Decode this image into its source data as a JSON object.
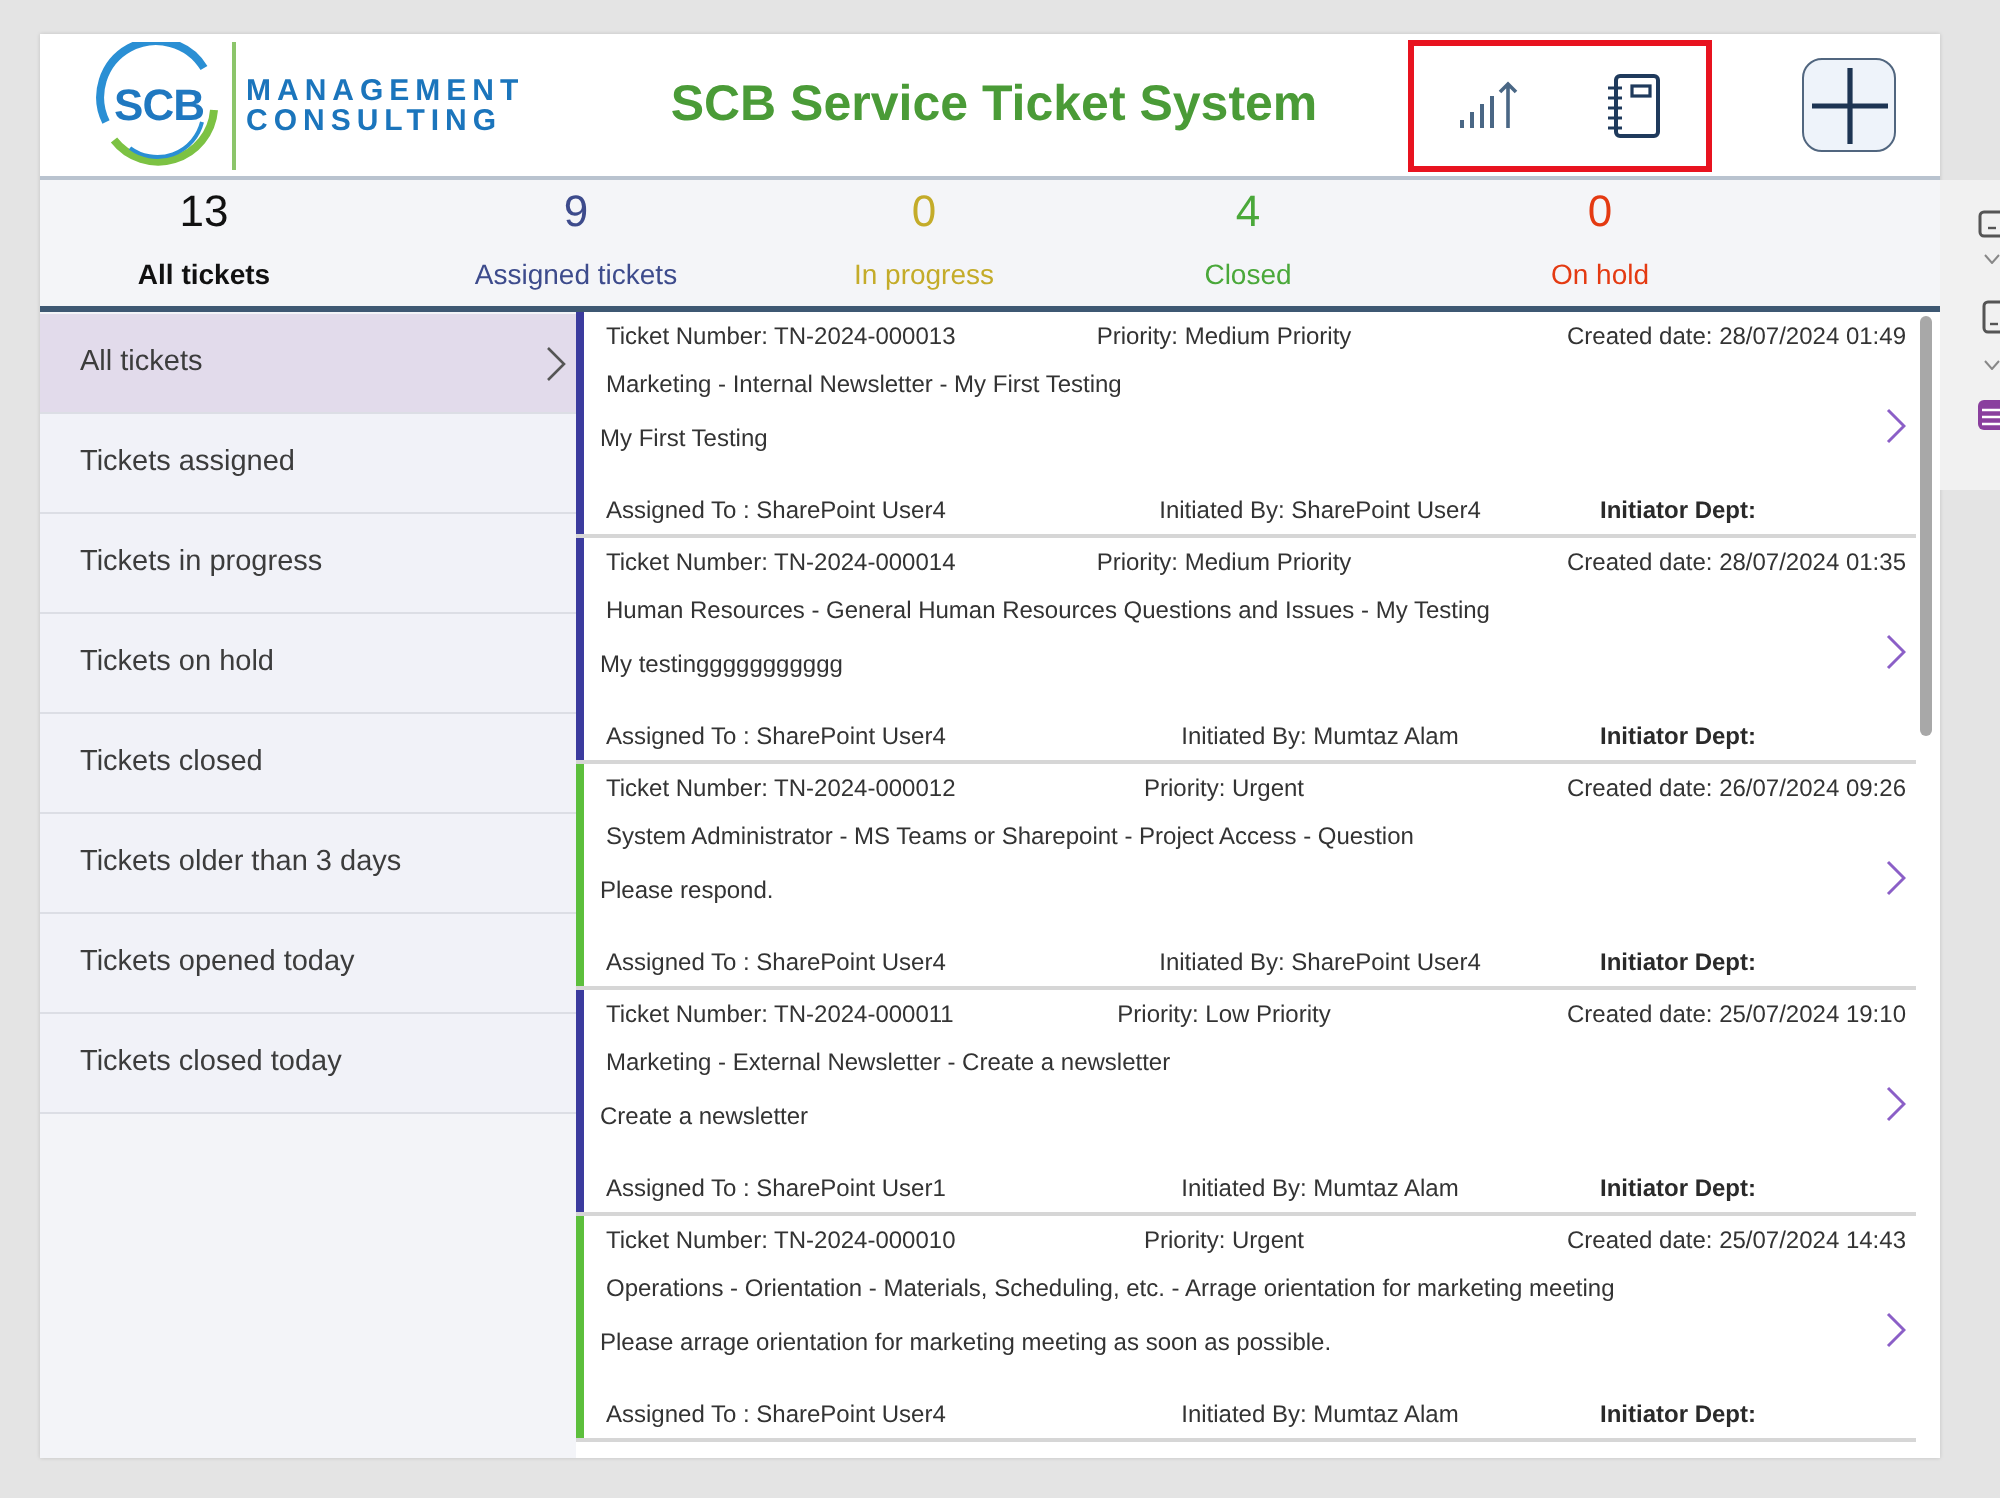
{
  "header": {
    "logo": {
      "initials": "SCB",
      "line1": "MANAGEMENT",
      "line2": "CONSULTING"
    },
    "title": "SCB Service Ticket System",
    "toolbar": {
      "highlighted": true
    }
  },
  "stats": [
    {
      "value": "13",
      "label": "All tickets",
      "color": "#111111",
      "selected": true
    },
    {
      "value": "9",
      "label": "Assigned tickets",
      "color": "#3d4b8c",
      "selected": false
    },
    {
      "value": "0",
      "label": "In progress",
      "color": "#c4ac2a",
      "selected": false
    },
    {
      "value": "4",
      "label": "Closed",
      "color": "#4aa83a",
      "selected": false
    },
    {
      "value": "0",
      "label": "On hold",
      "color": "#e43a12",
      "selected": false
    }
  ],
  "sidebar": {
    "items": [
      {
        "label": "All tickets",
        "selected": true
      },
      {
        "label": "Tickets assigned",
        "selected": false
      },
      {
        "label": "Tickets in progress",
        "selected": false
      },
      {
        "label": "Tickets on hold",
        "selected": false
      },
      {
        "label": "Tickets closed",
        "selected": false
      },
      {
        "label": "Tickets older than 3 days",
        "selected": false
      },
      {
        "label": "Tickets opened today",
        "selected": false
      },
      {
        "label": "Tickets closed today",
        "selected": false
      }
    ]
  },
  "tickets": [
    {
      "number": "Ticket Number: TN-2024-000013",
      "priority": "Priority: Medium Priority",
      "created": "Created date: 28/07/2024 01:49",
      "category": "Marketing - Internal Newsletter - My First Testing",
      "description": "My First Testing",
      "assigned_to": "Assigned To : SharePoint User4",
      "initiated_by": "Initiated By: SharePoint User4",
      "dept": "Initiator Dept:",
      "color": "#3b3b9e"
    },
    {
      "number": "Ticket Number: TN-2024-000014",
      "priority": "Priority: Medium Priority",
      "created": "Created date: 28/07/2024 01:35",
      "category": "Human Resources - General Human Resources Questions and Issues - My Testing",
      "description": "My testinggggggggggg",
      "assigned_to": "Assigned To : SharePoint User4",
      "initiated_by": "Initiated By: Mumtaz Alam",
      "dept": "Initiator Dept:",
      "color": "#3b3b9e"
    },
    {
      "number": "Ticket Number: TN-2024-000012",
      "priority": "Priority: Urgent",
      "created": "Created date: 26/07/2024 09:26",
      "category": "System Administrator - MS Teams or Sharepoint - Project Access - Question",
      "description": "Please respond.",
      "assigned_to": "Assigned To : SharePoint User4",
      "initiated_by": "Initiated By: SharePoint User4",
      "dept": "Initiator Dept:",
      "color": "#5cbf3c"
    },
    {
      "number": "Ticket Number: TN-2024-000011",
      "priority": "Priority: Low Priority",
      "created": "Created date: 25/07/2024 19:10",
      "category": "Marketing - External Newsletter - Create a newsletter",
      "description": "Create a newsletter",
      "assigned_to": "Assigned To : SharePoint User1",
      "initiated_by": "Initiated By: Mumtaz Alam",
      "dept": "Initiator Dept:",
      "color": "#3b3b9e"
    },
    {
      "number": "Ticket Number: TN-2024-000010",
      "priority": "Priority: Urgent",
      "created": "Created date: 25/07/2024 14:43",
      "category": "Operations - Orientation - Materials, Scheduling, etc. - Arrage orientation for marketing meeting",
      "description": "Please arrage orientation for marketing meeting as soon as possible.",
      "assigned_to": "Assigned To : SharePoint User4",
      "initiated_by": "Initiated By: Mumtaz Alam",
      "dept": "Initiator Dept:",
      "color": "#5cbf3c"
    }
  ]
}
